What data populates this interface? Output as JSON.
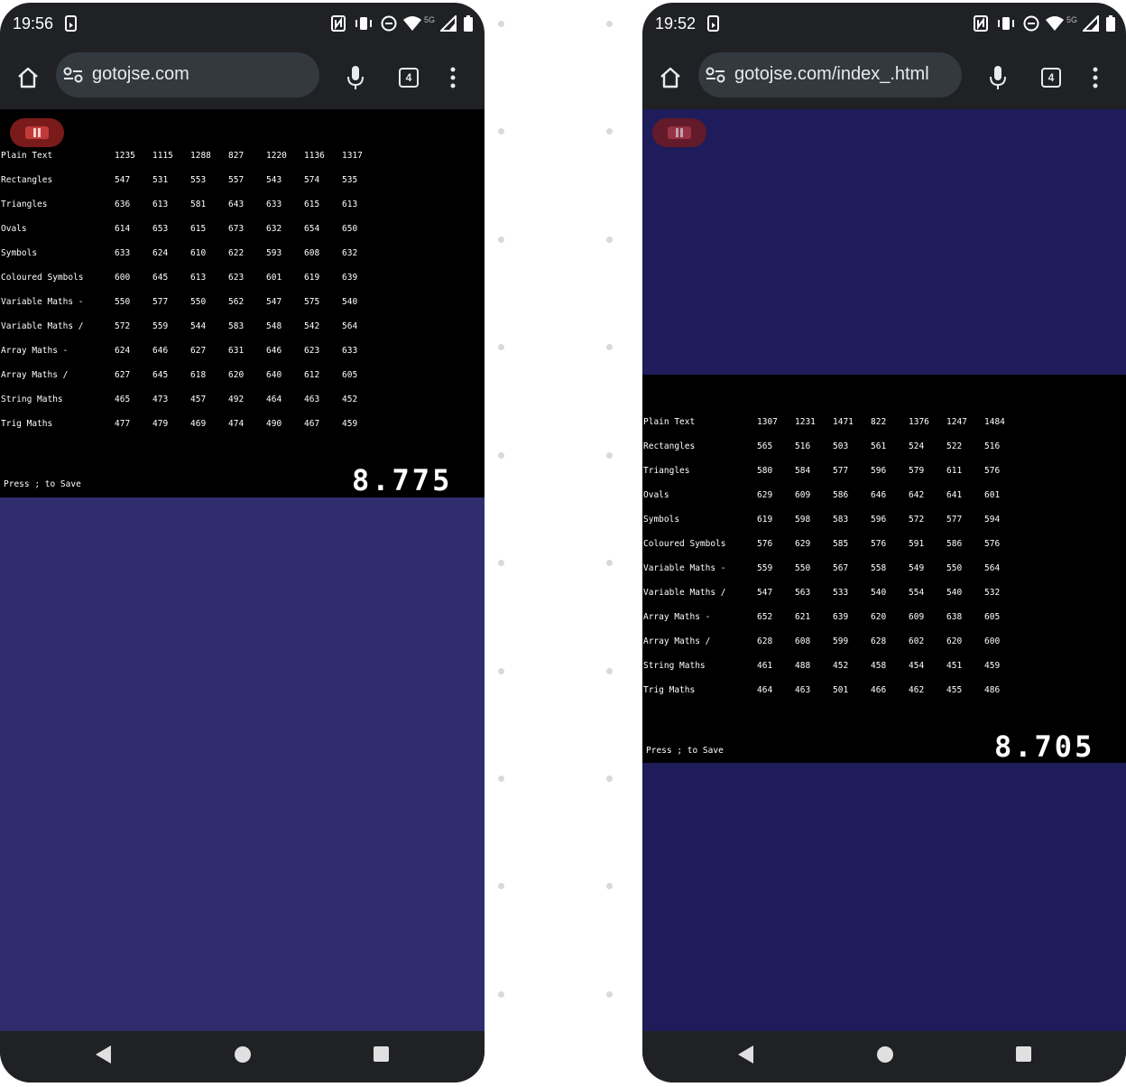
{
  "phones": [
    {
      "status": {
        "time": "19:56",
        "network": "5G"
      },
      "url": "gotojse.com",
      "tab_count": "4",
      "columns": [
        "1235",
        "1115",
        "1288",
        "827",
        "1220",
        "1136",
        "1317"
      ],
      "rows": [
        {
          "label": "Plain Text",
          "values": [
            "1235",
            "1115",
            "1288",
            "827",
            "1220",
            "1136",
            "1317"
          ]
        },
        {
          "label": "Rectangles",
          "values": [
            "547",
            "531",
            "553",
            "557",
            "543",
            "574",
            "535"
          ]
        },
        {
          "label": "Triangles",
          "values": [
            "636",
            "613",
            "581",
            "643",
            "633",
            "615",
            "613"
          ]
        },
        {
          "label": "Ovals",
          "values": [
            "614",
            "653",
            "615",
            "673",
            "632",
            "654",
            "650"
          ]
        },
        {
          "label": "Symbols",
          "values": [
            "633",
            "624",
            "610",
            "622",
            "593",
            "608",
            "632"
          ]
        },
        {
          "label": "Coloured Symbols",
          "values": [
            "600",
            "645",
            "613",
            "623",
            "601",
            "619",
            "639"
          ]
        },
        {
          "label": "Variable Maths -",
          "values": [
            "550",
            "577",
            "550",
            "562",
            "547",
            "575",
            "540"
          ]
        },
        {
          "label": "Variable Maths /",
          "values": [
            "572",
            "559",
            "544",
            "583",
            "548",
            "542",
            "564"
          ]
        },
        {
          "label": "Array Maths -",
          "values": [
            "624",
            "646",
            "627",
            "631",
            "646",
            "623",
            "633"
          ]
        },
        {
          "label": "Array Maths /",
          "values": [
            "627",
            "645",
            "618",
            "620",
            "640",
            "612",
            "605"
          ]
        },
        {
          "label": "String Maths",
          "values": [
            "465",
            "473",
            "457",
            "492",
            "464",
            "463",
            "452"
          ]
        },
        {
          "label": "Trig Maths",
          "values": [
            "477",
            "479",
            "469",
            "474",
            "490",
            "467",
            "459"
          ]
        }
      ],
      "save_text": "Press ; to Save",
      "score": "8.775",
      "bg_color": "#302d6e"
    },
    {
      "status": {
        "time": "19:52",
        "network": "5G"
      },
      "url": "gotojse.com/index_.html",
      "tab_count": "4",
      "rows": [
        {
          "label": "Plain Text",
          "values": [
            "1307",
            "1231",
            "1471",
            "822",
            "1376",
            "1247",
            "1484"
          ]
        },
        {
          "label": "Rectangles",
          "values": [
            "565",
            "516",
            "503",
            "561",
            "524",
            "522",
            "516"
          ]
        },
        {
          "label": "Triangles",
          "values": [
            "580",
            "584",
            "577",
            "596",
            "579",
            "611",
            "576"
          ]
        },
        {
          "label": "Ovals",
          "values": [
            "629",
            "609",
            "586",
            "646",
            "642",
            "641",
            "601"
          ]
        },
        {
          "label": "Symbols",
          "values": [
            "619",
            "598",
            "583",
            "596",
            "572",
            "577",
            "594"
          ]
        },
        {
          "label": "Coloured Symbols",
          "values": [
            "576",
            "629",
            "585",
            "576",
            "591",
            "586",
            "576"
          ]
        },
        {
          "label": "Variable Maths -",
          "values": [
            "559",
            "550",
            "567",
            "558",
            "549",
            "550",
            "564"
          ]
        },
        {
          "label": "Variable Maths /",
          "values": [
            "547",
            "563",
            "533",
            "540",
            "554",
            "540",
            "532"
          ]
        },
        {
          "label": "Array Maths -",
          "values": [
            "652",
            "621",
            "639",
            "620",
            "609",
            "638",
            "605"
          ]
        },
        {
          "label": "Array Maths /",
          "values": [
            "628",
            "608",
            "599",
            "628",
            "602",
            "620",
            "600"
          ]
        },
        {
          "label": "String Maths",
          "values": [
            "461",
            "488",
            "452",
            "458",
            "454",
            "451",
            "459"
          ]
        },
        {
          "label": "Trig Maths",
          "values": [
            "464",
            "463",
            "501",
            "466",
            "462",
            "455",
            "486"
          ]
        }
      ],
      "save_text": "Press ; to Save",
      "score": "8.705",
      "bg_color": "#1e1c5a"
    }
  ]
}
